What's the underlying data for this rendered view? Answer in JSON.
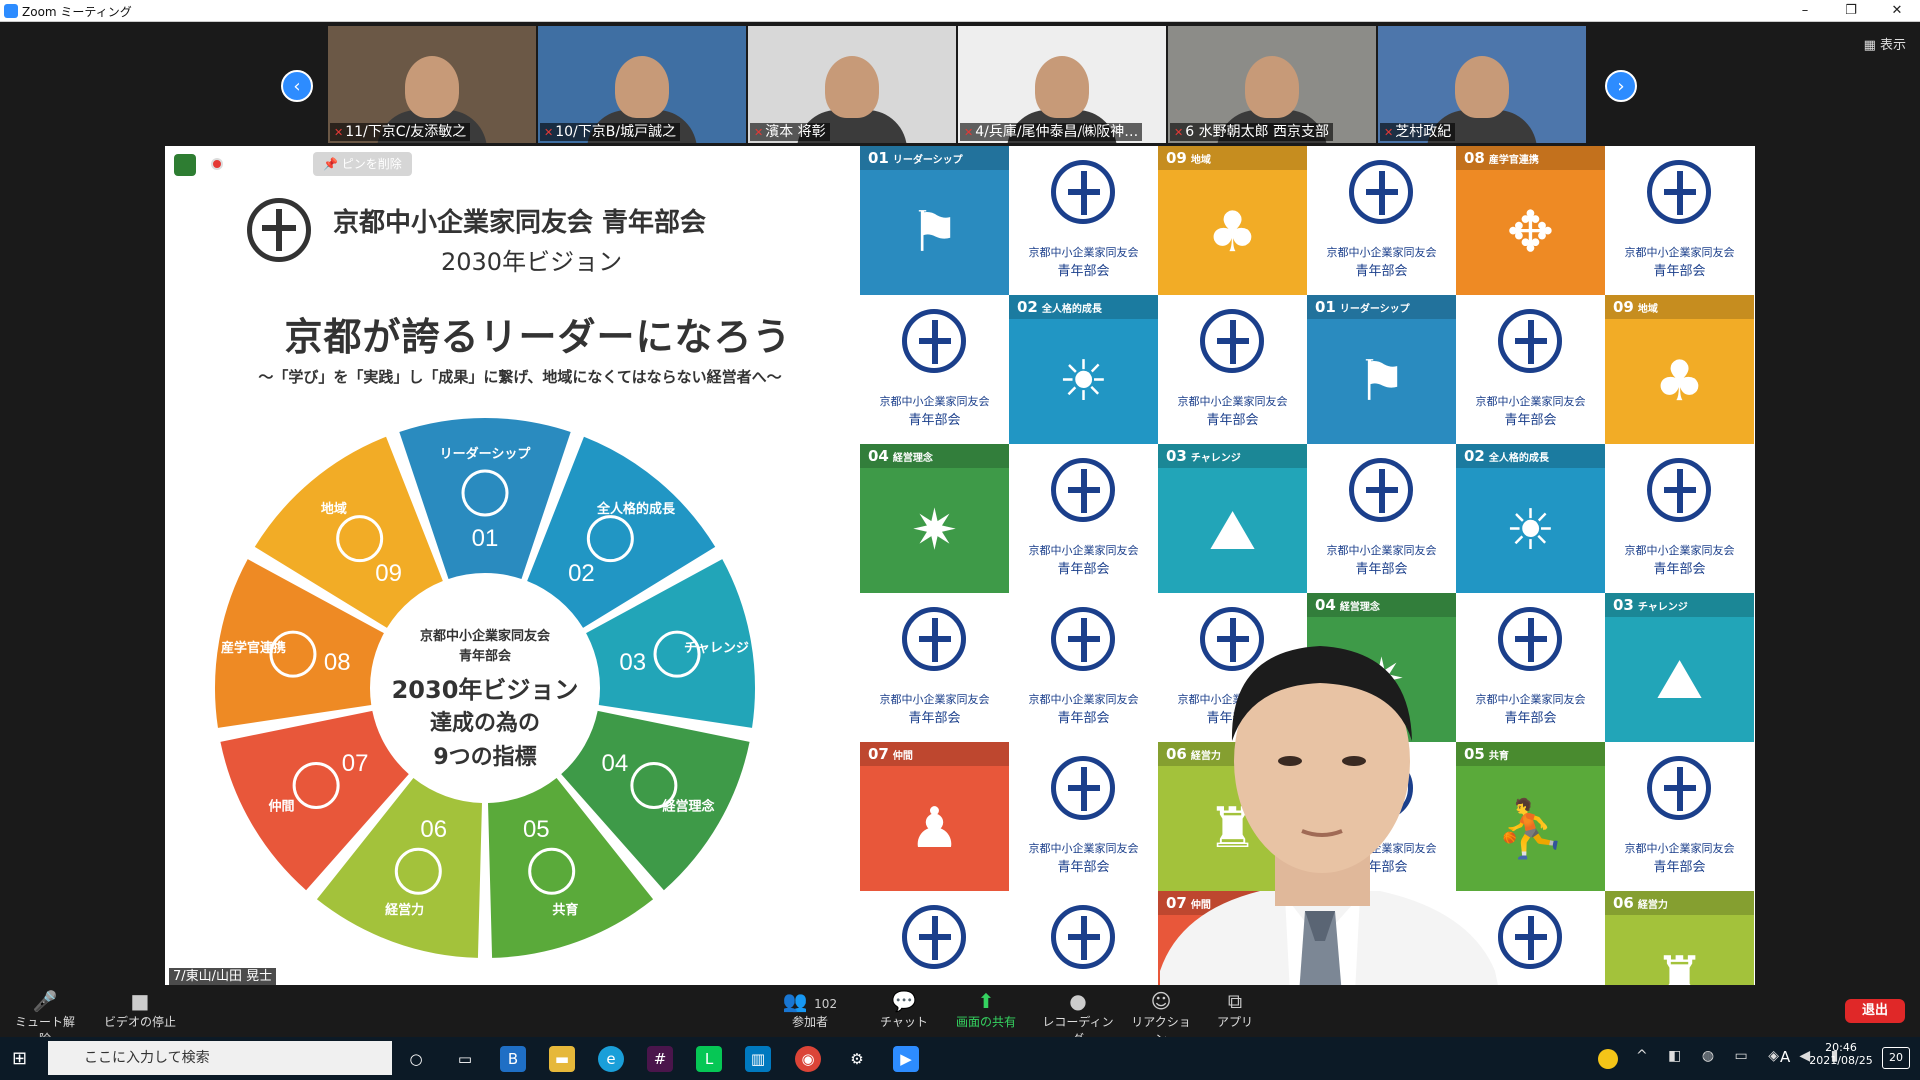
{
  "window": {
    "title": "Zoom ミーティング",
    "minimize": "–",
    "restore": "❐",
    "close": "✕"
  },
  "view_button": "▦ 表示",
  "nav": {
    "prev": "‹",
    "next": "›"
  },
  "participants": [
    {
      "name": "11/下京C/友添敏之",
      "bg": "#6b5846"
    },
    {
      "name": "10/下京B/城戸誠之",
      "bg": "#3f6fa3"
    },
    {
      "name": "濱本 将彰",
      "bg": "#d8d8d8"
    },
    {
      "name": "4/兵庫/尾仲泰昌/㈱阪神…",
      "bg": "#eeeeee"
    },
    {
      "name": "6 水野朝太郎 西京支部",
      "bg": "#8c8c88"
    },
    {
      "name": "芝村政紀",
      "bg": "#4d76ab"
    }
  ],
  "share": {
    "unpin": "📌 ピンを削除",
    "org_name": "京都中小企業家同友会  青年部会",
    "vision": "2030年ビジョン",
    "headline": "京都が誇るリーダーになろう",
    "subhead": "～「学び」を「実践」し「成果」に繋げ、地域になくてはならない経営者へ～",
    "center_line1": "京都中小企業家同友会",
    "center_line2": "青年部会",
    "center_line3": "2030年ビジョン",
    "center_line4": "達成の為の",
    "center_line5": "9つの指標",
    "segments": [
      {
        "num": "01",
        "label": "リーダーシップ",
        "color": "#2a8bbf"
      },
      {
        "num": "02",
        "label": "全人格的成長",
        "color": "#2196c4"
      },
      {
        "num": "03",
        "label": "チャレンジ",
        "color": "#22a5b8"
      },
      {
        "num": "04",
        "label": "経営理念",
        "color": "#3e9a48"
      },
      {
        "num": "05",
        "label": "共育",
        "color": "#5aaa3a"
      },
      {
        "num": "06",
        "label": "経営力",
        "color": "#a3c23b"
      },
      {
        "num": "07",
        "label": "仲間",
        "color": "#e8573a"
      },
      {
        "num": "08",
        "label": "産学官連携",
        "color": "#ee8a24"
      },
      {
        "num": "09",
        "label": "地域",
        "color": "#f2ac26"
      }
    ],
    "logo_text1": "京都中小企業家同友会",
    "logo_text2": "青年部会",
    "speaker_name": "7/東山/山田 晃士"
  },
  "toolbar": {
    "mute": "ミュート解除",
    "video": "ビデオの停止",
    "participants": "参加者",
    "participant_count": "102",
    "chat": "チャット",
    "share": "画面の共有",
    "record": "レコーディング",
    "reactions": "リアクション",
    "apps": "アプリ",
    "leave": "退出"
  },
  "taskbar": {
    "search_placeholder": "ここに入力して検索",
    "time": "20:46",
    "date": "2021/08/25",
    "ime": "A",
    "notifications": "20"
  }
}
